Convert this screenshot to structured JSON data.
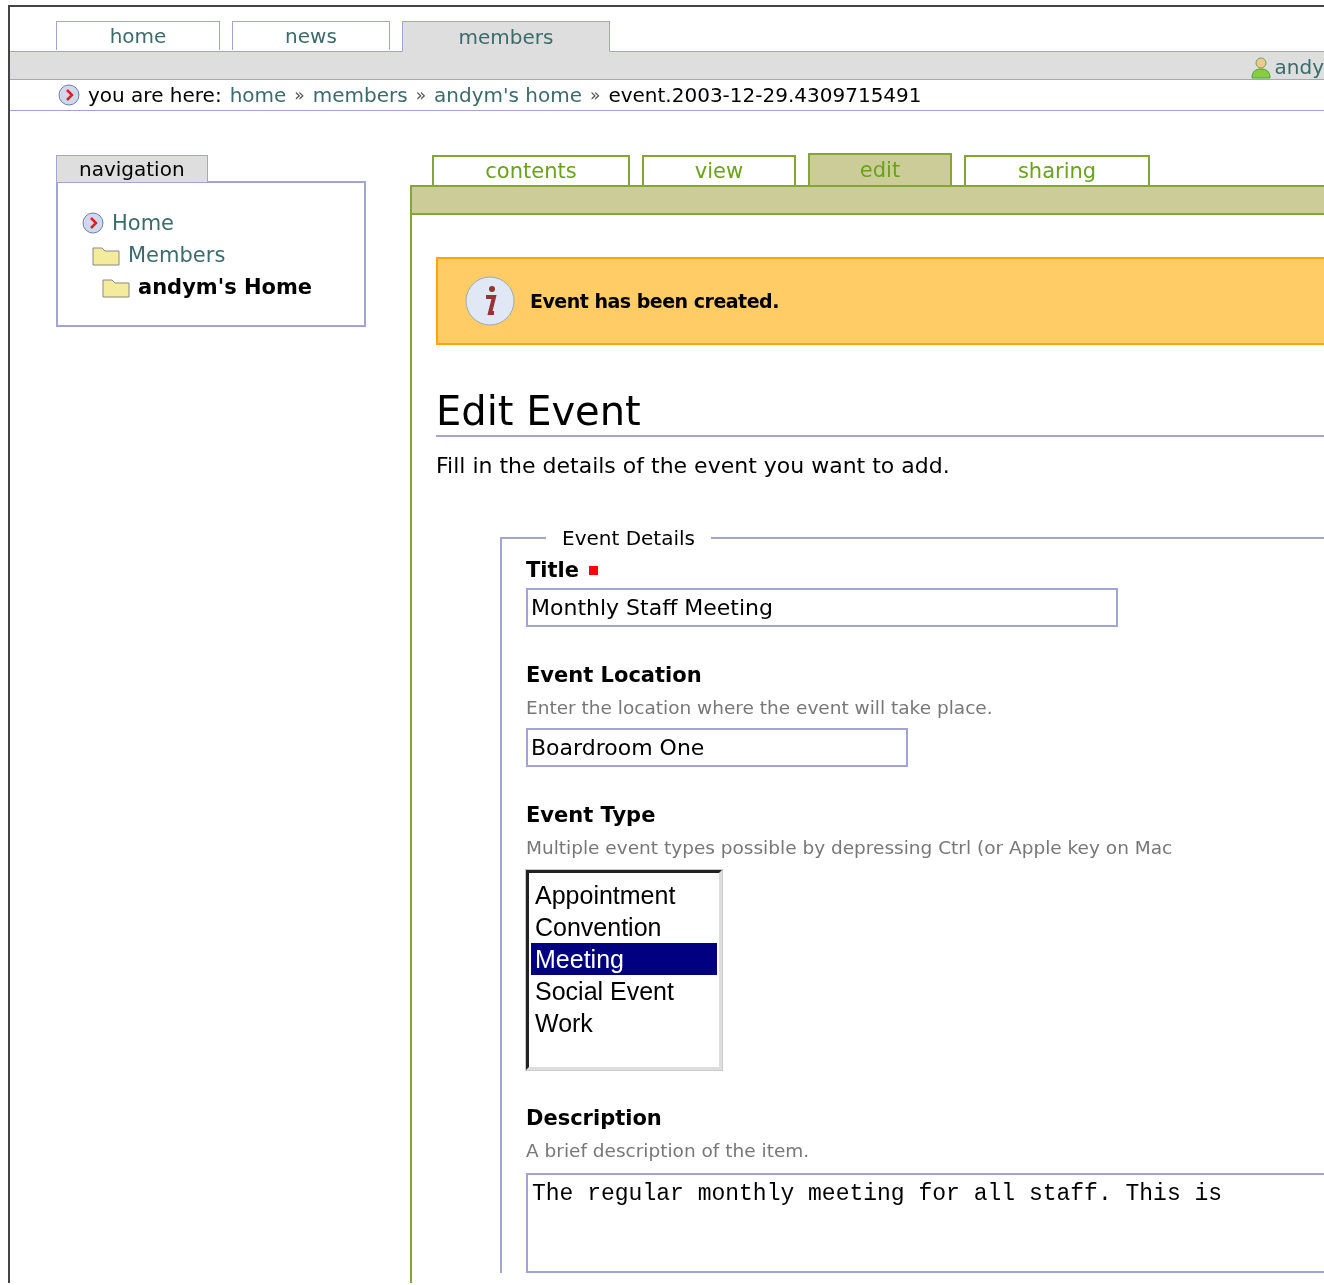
{
  "top_tabs": [
    {
      "label": "home",
      "selected": false
    },
    {
      "label": "news",
      "selected": false
    },
    {
      "label": "members",
      "selected": true
    }
  ],
  "user": {
    "name": "andy"
  },
  "breadcrumb": {
    "prefix": "you are here:",
    "separator": "»",
    "items": [
      {
        "label": "home",
        "kind": "link"
      },
      {
        "label": "members",
        "kind": "link"
      },
      {
        "label": "andym's home",
        "kind": "link"
      },
      {
        "label": "event.2003-12-29.4309715491",
        "kind": "current"
      }
    ]
  },
  "navigation": {
    "title": "navigation",
    "items": [
      {
        "label": "Home",
        "kind": "site",
        "selected": false,
        "children": [
          {
            "label": "Members",
            "kind": "folder",
            "selected": false,
            "children": [
              {
                "label": "andym's Home",
                "kind": "folder",
                "selected": true
              }
            ]
          }
        ]
      }
    ]
  },
  "content_tabs": [
    {
      "label": "contents",
      "selected": false
    },
    {
      "label": "view",
      "selected": false
    },
    {
      "label": "edit",
      "selected": true
    },
    {
      "label": "sharing",
      "selected": false
    }
  ],
  "message": "Event has been created.",
  "heading": "Edit Event",
  "intro": "Fill in the details of the event you want to add.",
  "fieldset": {
    "legend": "Event Details",
    "fields": [
      {
        "kind": "text",
        "label": "Title",
        "required": true,
        "value": "Monthly Staff Meeting"
      },
      {
        "kind": "short_text",
        "label": "Event Location",
        "required": false,
        "help": "Enter the location where the event will take place.",
        "value": "Boardroom One"
      },
      {
        "kind": "multiselect",
        "label": "Event Type",
        "required": false,
        "help": "Multiple event types possible by depressing Ctrl (or Apple key on Mac",
        "options": [
          {
            "label": "Appointment",
            "selected": false
          },
          {
            "label": "Convention",
            "selected": false
          },
          {
            "label": "Meeting",
            "selected": true
          },
          {
            "label": "Social Event",
            "selected": false
          },
          {
            "label": "Work",
            "selected": false
          }
        ]
      },
      {
        "kind": "textarea",
        "label": "Description",
        "required": false,
        "help": "A brief description of the item.",
        "value": "The regular monthly meeting for all staff. This is"
      }
    ]
  }
}
